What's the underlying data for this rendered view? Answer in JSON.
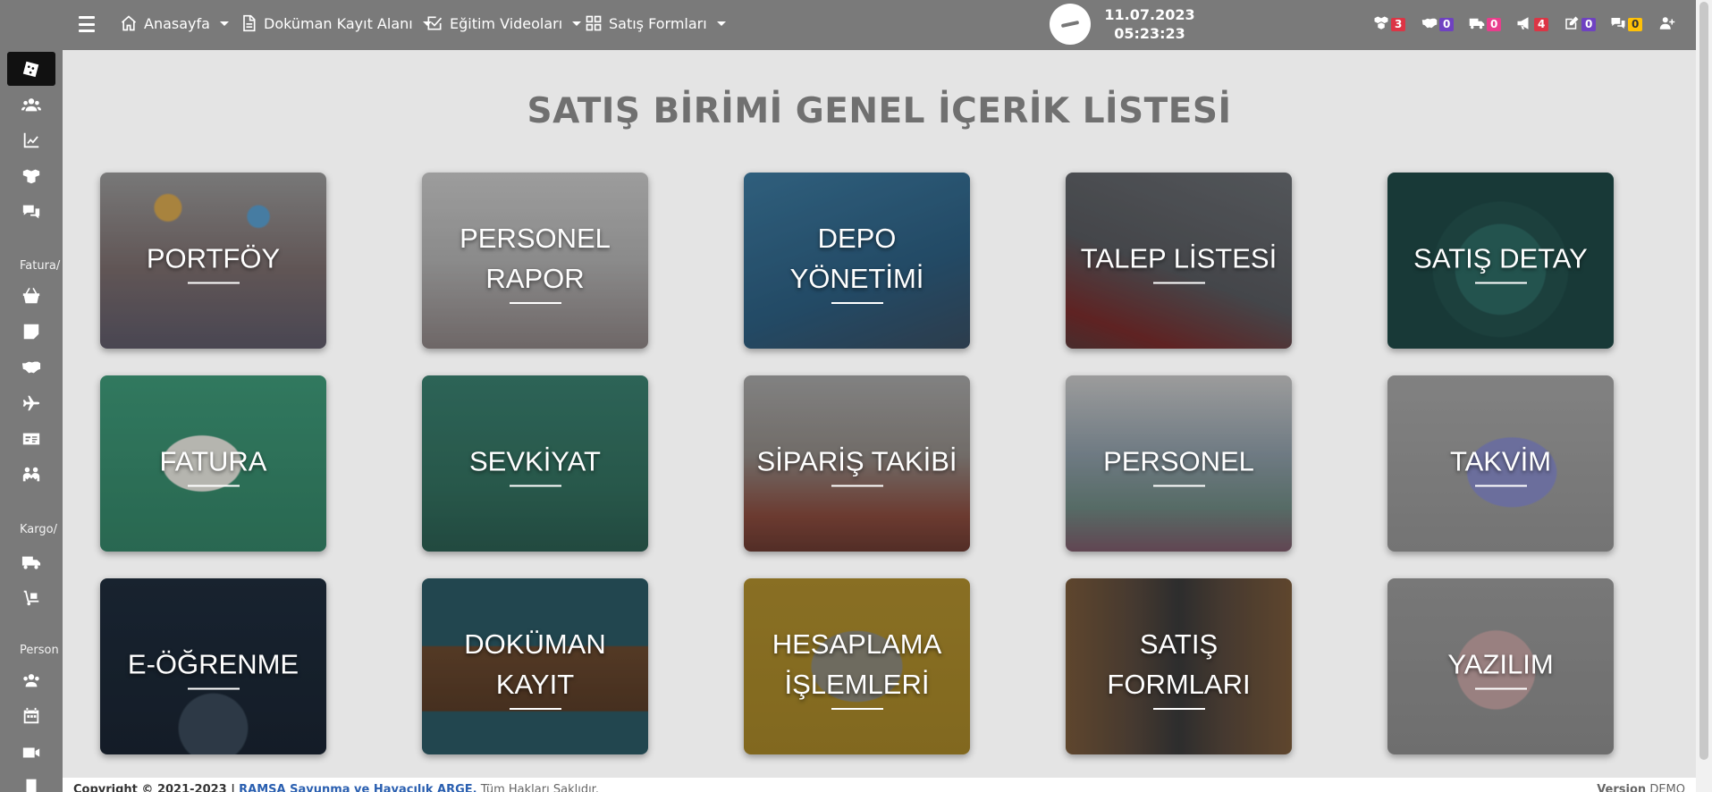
{
  "sidebar": {
    "groups": [
      "Fatura/",
      "Kargo/",
      "Person"
    ]
  },
  "topbar": {
    "menu": [
      {
        "label": "Anasayfa",
        "icon": "home-icon"
      },
      {
        "label": "Doküman Kayıt Alanı",
        "icon": "document-icon"
      },
      {
        "label": "Eğitim Videoları",
        "icon": "checkbox-icon"
      },
      {
        "label": "Satış Formları",
        "icon": "grid-icon"
      }
    ],
    "date": "11.07.2023",
    "time": "05:23:23",
    "notifications": [
      {
        "icon": "cubes-icon",
        "count": "3",
        "color": "#dc3545"
      },
      {
        "icon": "handshake-icon",
        "count": "0",
        "color": "#6f42c1"
      },
      {
        "icon": "truck-icon",
        "count": "0",
        "color": "#e83e8c"
      },
      {
        "icon": "megaphone-icon",
        "count": "4",
        "color": "#dc3545"
      },
      {
        "icon": "edit-icon",
        "count": "0",
        "color": "#6f42c1"
      },
      {
        "icon": "chat-icon",
        "count": "0",
        "color": "#ffc107"
      },
      {
        "icon": "user-plus-icon",
        "count": "",
        "color": ""
      }
    ]
  },
  "main": {
    "title": "SATIŞ BİRİMİ GENEL İÇERİK LİSTESİ",
    "cards": [
      {
        "line1": "PORTFÖY",
        "line2": ""
      },
      {
        "line1": "PERSONEL",
        "line2": "RAPOR"
      },
      {
        "line1": "DEPO",
        "line2": "YÖNETİMİ"
      },
      {
        "line1": "TALEP LİSTESİ",
        "line2": ""
      },
      {
        "line1": "SATIŞ DETAY",
        "line2": ""
      },
      {
        "line1": "FATURA",
        "line2": ""
      },
      {
        "line1": "SEVKİYAT",
        "line2": ""
      },
      {
        "line1": "SİPARİŞ TAKİBİ",
        "line2": ""
      },
      {
        "line1": "PERSONEL",
        "line2": ""
      },
      {
        "line1": "TAKVİM",
        "line2": ""
      },
      {
        "line1": "E-ÖĞRENME",
        "line2": ""
      },
      {
        "line1": "DOKÜMAN",
        "line2": "KAYIT"
      },
      {
        "line1": "HESAPLAMA",
        "line2": "İŞLEMLERİ"
      },
      {
        "line1": "SATIŞ",
        "line2": "FORMLARI"
      },
      {
        "line1": "YAZILIM",
        "line2": ""
      }
    ]
  },
  "footer": {
    "copyright": "Copyright © 2021-2023 |",
    "company": "RAMSA Savunma ve Havacılık ARGE.",
    "rights": "Tüm Hakları Saklıdır.",
    "version_label": "Version",
    "version_value": "DEMO"
  },
  "colors": {
    "chrome": "#7a7a7a",
    "background": "#e4e4e4",
    "title": "#707070"
  }
}
